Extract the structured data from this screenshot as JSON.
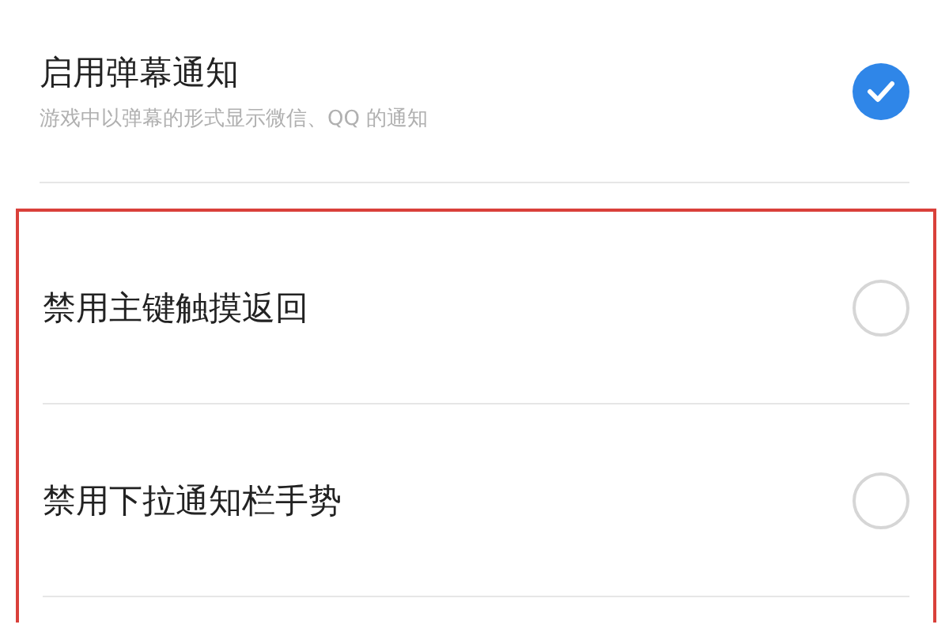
{
  "settings": [
    {
      "title": "启用弹幕通知",
      "subtitle": "游戏中以弹幕的形式显示微信、QQ 的通知",
      "checked": true,
      "highlighted": false
    },
    {
      "title": "禁用主键触摸返回",
      "checked": false,
      "highlighted": true
    },
    {
      "title": "禁用下拉通知栏手势",
      "checked": false,
      "highlighted": true
    }
  ]
}
